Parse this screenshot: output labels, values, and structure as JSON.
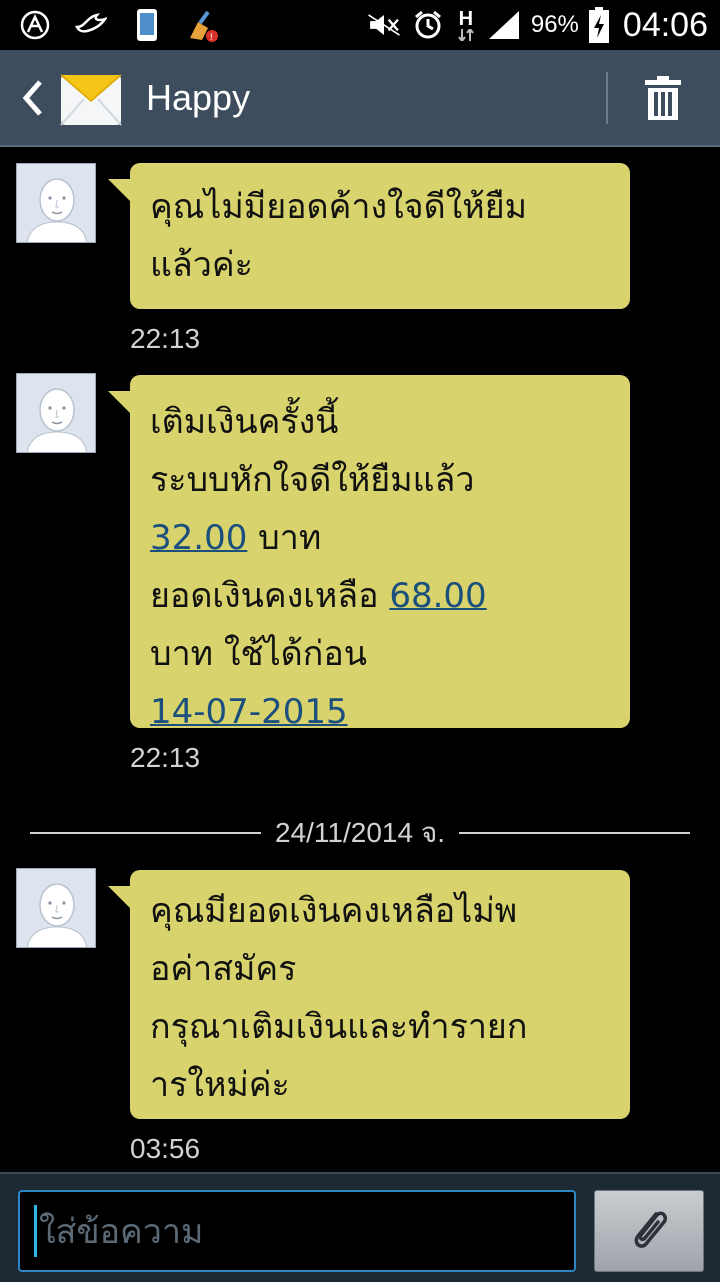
{
  "status_bar": {
    "battery": "96%",
    "time": "04:06",
    "network": "H",
    "icons": [
      "android-wear-icon",
      "bird-icon",
      "phone-icon",
      "cleaner-icon",
      "mute-icon",
      "alarm-icon",
      "network-h-icon",
      "signal-icon",
      "battery-icon"
    ]
  },
  "header": {
    "title": "Happy",
    "icons": [
      "back-icon",
      "envelope-icon",
      "trash-icon"
    ]
  },
  "messages": [
    {
      "lines": [
        "คุณไม่มียอดค้างใจดีให้ยืม",
        "แล้วค่ะ"
      ],
      "time": "22:13"
    },
    {
      "lines": [
        "เติมเงินครั้งนี้",
        "ระบบหักใจดีให้ยืมแล้ว"
      ],
      "amount_deducted": "32.00",
      "unit": "บาท",
      "balance_label": "ยอดเงินคงเหลือ",
      "balance": "68.00",
      "valid_label": "บาท ใช้ได้ก่อน",
      "expiry": "14-07-2015",
      "time": "22:13"
    },
    {
      "lines": [
        "คุณมียอดเงินคงเหลือไม่พ",
        "อค่าสมัคร",
        "กรุณาเติมเงินและทำรายก",
        "ารใหม่ค่ะ"
      ],
      "time": "03:56"
    }
  ],
  "date_separator": "24/11/2014 จ.",
  "composer": {
    "placeholder": "ใส่ข้อความ",
    "attach_icon": "paperclip-icon"
  },
  "colors": {
    "bubble": "#d8d36c",
    "header": "#3d4d5e",
    "link": "#1a4f7e",
    "accent": "#33b5e5"
  }
}
